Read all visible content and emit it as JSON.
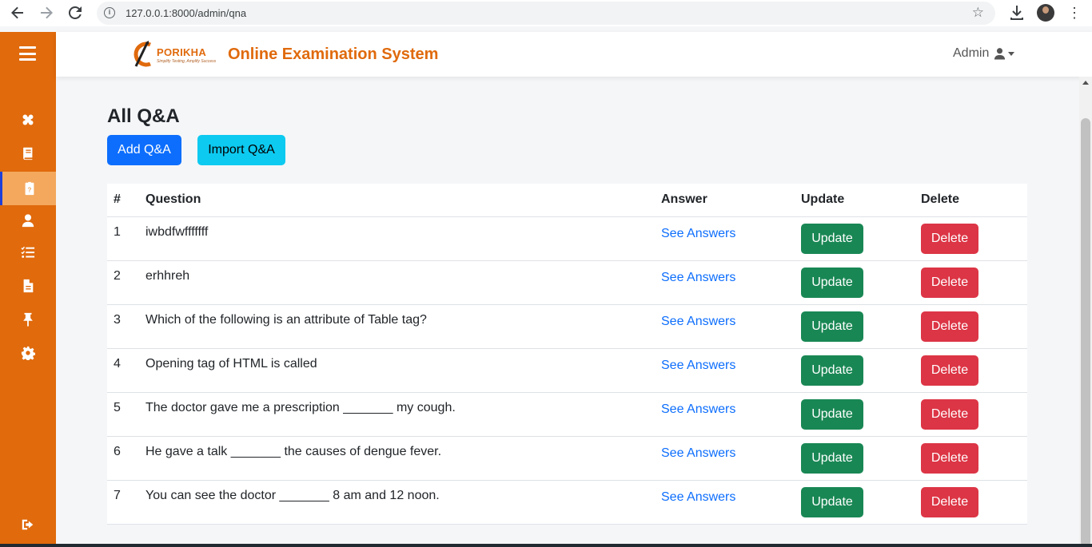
{
  "browser": {
    "url": "127.0.0.1:8000/admin/qna",
    "icons": [
      "back-arrow-icon",
      "forward-arrow-icon",
      "reload-icon",
      "info-icon",
      "star-icon",
      "download-icon",
      "profile-avatar",
      "kebab-menu-icon"
    ]
  },
  "sidebar": {
    "color": "#e06a0c",
    "items": [
      {
        "icon": "dashboard-icon"
      },
      {
        "icon": "book-icon"
      },
      {
        "icon": "qna-icon",
        "active": true
      },
      {
        "icon": "user-icon"
      },
      {
        "icon": "list-check-icon"
      },
      {
        "icon": "file-icon"
      },
      {
        "icon": "pin-icon"
      },
      {
        "icon": "settings-icon"
      },
      {
        "icon": "logout-icon"
      }
    ]
  },
  "header": {
    "logo_text": "PORIKHA",
    "logo_tagline": "Simplify Testing, Amplify Success",
    "app_title": "Online Examination System",
    "admin_label": "Admin"
  },
  "main": {
    "title": "All Q&A",
    "add_button": "Add Q&A",
    "import_button": "Import Q&A",
    "table": {
      "headers": [
        "#",
        "Question",
        "Answer",
        "Update",
        "Delete"
      ],
      "rows": [
        {
          "num": "1",
          "question": "iwbdfwfffffff",
          "answer": "See Answers",
          "update": "Update",
          "delete": "Delete"
        },
        {
          "num": "2",
          "question": "erhhreh",
          "answer": "See Answers",
          "update": "Update",
          "delete": "Delete"
        },
        {
          "num": "3",
          "question": "Which of the following is an attribute of Table tag?",
          "answer": "See Answers",
          "update": "Update",
          "delete": "Delete"
        },
        {
          "num": "4",
          "question": "Opening tag of HTML is called",
          "answer": "See Answers",
          "update": "Update",
          "delete": "Delete"
        },
        {
          "num": "5",
          "question": "The doctor gave me a prescription _______ my cough.",
          "answer": "See Answers",
          "update": "Update",
          "delete": "Delete"
        },
        {
          "num": "6",
          "question": "He gave a talk _______ the causes of dengue fever.",
          "answer": "See Answers",
          "update": "Update",
          "delete": "Delete"
        },
        {
          "num": "7",
          "question": "You can see the doctor _______ 8 am and 12 noon.",
          "answer": "See Answers",
          "update": "Update",
          "delete": "Delete"
        }
      ]
    }
  }
}
